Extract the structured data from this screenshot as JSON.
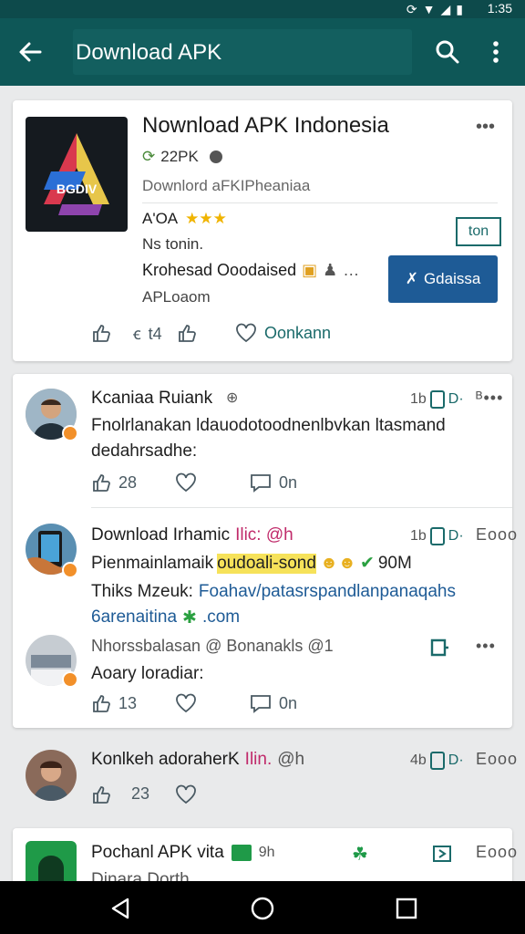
{
  "status_bar": {
    "time": "1:35"
  },
  "app_bar": {
    "search_text": "Download APK"
  },
  "app_card": {
    "title": "Nownload APK Indonesia",
    "downloads": "22PK",
    "subtitle": "Downlord aFKIPheaniaa",
    "rating_label": "A'OA",
    "stars": "★★★",
    "line2": "Ns tonin.",
    "line3": "Krohesad Ooodaised",
    "line4": "APLoaom",
    "open_button": "ton",
    "install_button": "Gdaissa",
    "like_count": "t4",
    "save_label": "Oonkann"
  },
  "posts": [
    {
      "name": "Kcaniaa Ruiank",
      "time": "1b",
      "text1": "Fnolrlanakan ldauodotoodnenlbvkan ltasmand",
      "text2": "dedahrsadhe:",
      "likes": "28",
      "comments": "0n"
    },
    {
      "name": "Download Irhamic",
      "name_extra": "Ilic: @h",
      "time": "1b",
      "text1": "Pienmainlamaik",
      "text1_highlight": "oudoali-sond",
      "text1_after": "90M",
      "text2_label": "Thiks Mzeuk:",
      "text2_link": "Foahav/patasrspandlanpanaqahs",
      "text3_link": "6arenaitina",
      "text3_after": ".com"
    },
    {
      "name": "Nhorssbalasan @ Bonanakls @1",
      "text1": "Aoary loradiar:",
      "likes": "13",
      "comments": "0n"
    },
    {
      "name": "Konlkeh adoraherK",
      "name_extra": "Ilin.",
      "name_handle": "@h",
      "time": "4b",
      "likes": "23"
    },
    {
      "name": "Pochanl APK vita",
      "handle": "9h",
      "text1": "Dinara Dorth"
    }
  ],
  "more_label": "Eooo",
  "colors": {
    "app_bar": "#0e5757",
    "accent": "#1e5b96",
    "teal": "#1a6a6a"
  }
}
